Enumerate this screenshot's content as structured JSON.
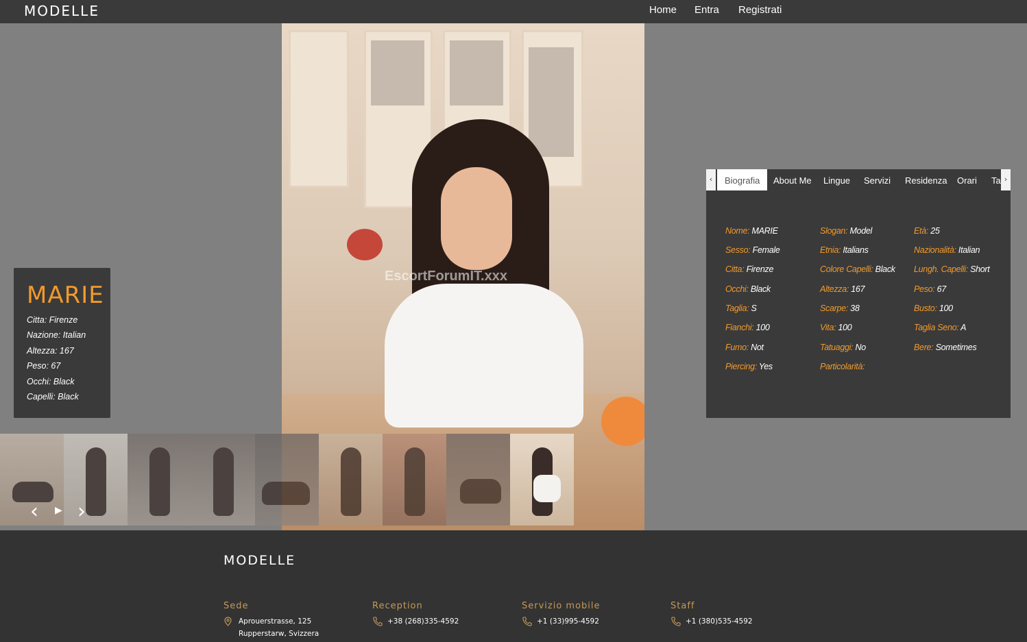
{
  "header": {
    "brand": "MODELLE",
    "nav": [
      "Home",
      "Entra",
      "Registrati"
    ]
  },
  "hero": {
    "watermark": "EscortForumIT.xxx"
  },
  "card": {
    "name": "MARIE",
    "lines": [
      "Citta: Firenze",
      "Nazione: Italian",
      "Altezza: 167",
      "Peso: 67",
      "Occhi: Black",
      "Capelli: Black"
    ]
  },
  "gallery": {
    "prev_icon": "‹",
    "play_icon": "▶",
    "next_icon": "›",
    "thumb_count": 9,
    "active_index": 8
  },
  "tabs": {
    "left_icon": "‹",
    "right_icon": "›",
    "items": [
      "Biografia",
      "About Me",
      "Lingue",
      "Servizi",
      "Residenza",
      "Orari",
      "Ta"
    ],
    "active": "Biografia"
  },
  "bio": [
    [
      {
        "k": "Nome:",
        "v": "MARIE"
      },
      {
        "k": "Slogan:",
        "v": "Model"
      },
      {
        "k": "Età:",
        "v": "25"
      }
    ],
    [
      {
        "k": "Sesso:",
        "v": "Female"
      },
      {
        "k": "Etnia:",
        "v": "Italians"
      },
      {
        "k": "Nazionalità:",
        "v": "Italian"
      }
    ],
    [
      {
        "k": "Citta:",
        "v": "Firenze"
      },
      {
        "k": "Colore Capelli:",
        "v": "Black"
      },
      {
        "k": "Lungh. Capelli:",
        "v": "Short"
      }
    ],
    [
      {
        "k": "Occhi:",
        "v": "Black"
      },
      {
        "k": "Altezza:",
        "v": "167"
      },
      {
        "k": "Peso:",
        "v": "67"
      }
    ],
    [
      {
        "k": "Taglia:",
        "v": "S"
      },
      {
        "k": "Scarpe:",
        "v": "38"
      },
      {
        "k": "Busto:",
        "v": "100"
      }
    ],
    [
      {
        "k": "Fianchi:",
        "v": "100"
      },
      {
        "k": "Vita:",
        "v": "100"
      },
      {
        "k": "Taglia Seno:",
        "v": "A"
      }
    ],
    [
      {
        "k": "Fumo:",
        "v": "Not"
      },
      {
        "k": "Tatuaggi:",
        "v": "No"
      },
      {
        "k": "Bere:",
        "v": "Sometimes"
      }
    ],
    [
      {
        "k": "Piercing:",
        "v": "Yes"
      },
      {
        "k": "Particolarità:",
        "v": ""
      }
    ]
  ],
  "footer": {
    "brand": "MODELLE",
    "columns": [
      {
        "title": "Sede",
        "icon": "location-icon",
        "lines": [
          "Aprouerstrasse, 125",
          "Rupperstarw, Svizzera"
        ]
      },
      {
        "title": "Reception",
        "icon": "phone-icon",
        "lines": [
          "+38 (268)335-4592"
        ]
      },
      {
        "title": "Servizio mobile",
        "icon": "phone-icon",
        "lines": [
          "+1 (33)995-4592"
        ]
      },
      {
        "title": "Staff",
        "icon": "phone-icon",
        "lines": [
          "+1 (380)535-4592"
        ]
      }
    ]
  },
  "colors": {
    "accent": "#f39a2b",
    "footer_accent": "#c59a58",
    "panel": "#3a3a3a",
    "page": "#808080"
  }
}
